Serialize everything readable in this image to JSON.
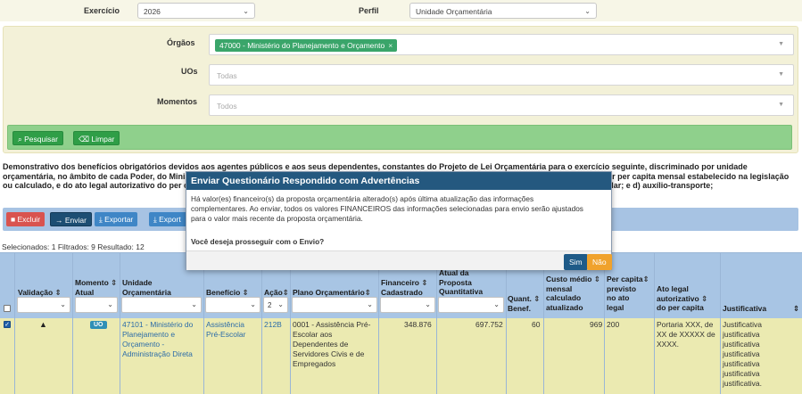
{
  "header": {
    "exercicio_label": "Exercício",
    "exercicio_value": "2026",
    "perfil_label": "Perfil",
    "perfil_value": "Unidade Orçamentária"
  },
  "filters": {
    "orgaos_label": "Órgãos",
    "orgaos_tag": "47000 - Ministério do Planejamento e Orçamento",
    "uos_label": "UOs",
    "uos_placeholder": "Todas",
    "momentos_label": "Momentos",
    "momentos_placeholder": "Todos",
    "search_label": "Pesquisar",
    "clear_label": "Limpar"
  },
  "description": "Demonstrativo dos benefícios obrigatórios devidos aos agentes públicos e aos seus dependentes, constantes do Projeto de Lei Orçamentária para o exercício seguinte, discriminado por unidade orçamentária, no âmbito de cada Poder, do Ministério Público da União e da Defensoria Pública da União, contendo: a) o quantitativo de beneficiários; b) o valor per capita mensal estabelecido na legislação ou calculado, e do ato legal autorizativo do per capita, para os benefícios: a) auxílio-alimentação; b) assistência médica e odontológica; c) assistência pré-escolar; e d) auxílio-transporte;",
  "toolbar": {
    "excluir": "Excluir",
    "enviar": "Enviar",
    "exportar": "Exportar",
    "exportar2": "Export"
  },
  "counts": "Selecionados: 1 Filtrados: 9 Resultado: 12",
  "table": {
    "headers": {
      "validacao": "Validação",
      "momento": [
        "Momento",
        "Atual"
      ],
      "unidade": [
        "Unidade",
        "Orçamentária"
      ],
      "beneficio": "Benefício",
      "acao": "Ação",
      "plano": "Plano Orçamentário",
      "financeiro": [
        "Financeiro",
        "Cadastrado"
      ],
      "proposta": [
        "Atual da",
        "Proposta",
        "Quantitativa"
      ],
      "quant": [
        "Quant.",
        "Benef."
      ],
      "custo": [
        "Custo médio",
        "mensal",
        "calculado",
        "atualizado"
      ],
      "percapita": [
        "Per capita",
        "previsto",
        "no ato",
        "legal"
      ],
      "ato": [
        "Ato legal",
        "autorizativo",
        "do per capita"
      ],
      "justificativa": "Justificativa"
    },
    "acao_filter_value": "2",
    "row": {
      "momento": "UO",
      "unidade": [
        "47101 - Ministério do",
        "Planejamento e",
        "Orçamento -",
        "Administração Direta"
      ],
      "beneficio": [
        "Assistência",
        "Pré-Escolar"
      ],
      "acao": "212B",
      "plano": [
        "0001 - Assistência Pré-",
        "Escolar aos",
        "Dependentes de",
        "Servidores Civis e de",
        "Empregados"
      ],
      "financeiro": "348.876",
      "proposta": "697.752",
      "quant": "60",
      "custo": "969",
      "percapita": "200",
      "ato": [
        "Portaria XXX, de",
        "XX de XXXXX de",
        "XXXX."
      ],
      "justificativa": [
        "Justificativa",
        "justificativa",
        "justificativa",
        "justificativa",
        "justificativa",
        "justificativa",
        "justificativa."
      ]
    }
  },
  "modal": {
    "title": "Enviar Questionário Respondido com Advertências",
    "body": [
      "Há valor(es) financeiro(s) da proposta orçamentária alterado(s) após última atualização das informações",
      "complementares. Ao enviar, todos os valores FINANCEIROS das informações selecionadas para envio serão ajustados",
      "para o valor mais recente da proposta orçamentária."
    ],
    "question": "Você deseja prosseguir com o Envio?",
    "yes": "Sim",
    "no": "Não"
  }
}
